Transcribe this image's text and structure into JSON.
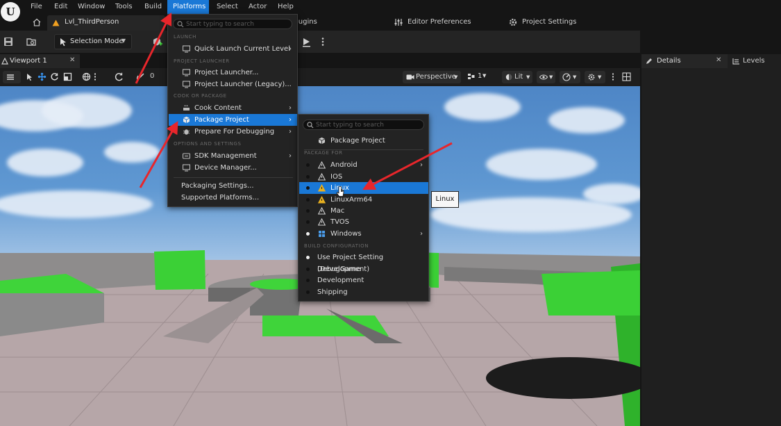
{
  "menubar": {
    "logo": "U",
    "items": [
      "File",
      "Edit",
      "Window",
      "Tools",
      "Build",
      "Platforms",
      "Select",
      "Actor",
      "Help"
    ]
  },
  "titlerow": {
    "level_name": "Lvl_ThirdPerson",
    "plugins_fragment": "lugins",
    "editor_preferences": "Editor Preferences",
    "project_settings": "Project Settings"
  },
  "toolbar": {
    "selection_mode": "Selection Mode"
  },
  "viewport": {
    "tab_label": "Viewport 1",
    "snap_value": "0",
    "perspective": "Perspective",
    "camera_speed": "1",
    "lit": "Lit"
  },
  "details": {
    "tab_label": "Details",
    "levels_label": "Levels"
  },
  "platforms_menu": {
    "search_placeholder": "Start typing to search",
    "sections": {
      "launch": "LAUNCH",
      "project_launcher": "PROJECT LAUNCHER",
      "cook_or_package": "COOK OR PACKAGE",
      "options_and_settings": "OPTIONS AND SETTINGS"
    },
    "items": {
      "quick_launch": "Quick Launch Current Level",
      "project_launcher": "Project Launcher...",
      "project_launcher_legacy": "Project Launcher (Legacy)...",
      "cook_content": "Cook Content",
      "package_project": "Package Project",
      "prepare_for_debugging": "Prepare For Debugging",
      "sdk_management": "SDK Management",
      "device_manager": "Device Manager...",
      "packaging_settings": "Packaging Settings...",
      "supported_platforms": "Supported Platforms..."
    }
  },
  "package_submenu": {
    "search_placeholder": "Start typing to search",
    "package_project": "Package Project",
    "section_package_for": "PACKAGE FOR",
    "platforms": [
      "Android",
      "IOS",
      "Linux",
      "LinuxArm64",
      "Mac",
      "TVOS",
      "Windows"
    ],
    "section_build_configuration": "BUILD CONFIGURATION",
    "build_configs": [
      "Use Project Setting (Development)",
      "DebugGame",
      "Development",
      "Shipping"
    ]
  },
  "tooltip": {
    "text": "Linux"
  },
  "colors": {
    "highlight": "#1a78d6",
    "annotation_arrow": "#e8262b",
    "level_green": "#3fd43a"
  }
}
